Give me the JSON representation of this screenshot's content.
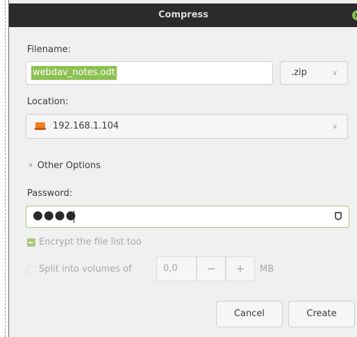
{
  "window": {
    "title": "Compress"
  },
  "filename": {
    "label": "Filename:",
    "value": "webdav_notes.odt",
    "extension": ".zip"
  },
  "location": {
    "label": "Location:",
    "value": "192.168.1.104"
  },
  "other_options": {
    "label": "Other Options"
  },
  "password": {
    "label": "Password:",
    "value": "●●●●"
  },
  "encrypt": {
    "label": "Encrypt the file list too",
    "checked": true
  },
  "split": {
    "label": "Split into volumes of",
    "value": "0,0",
    "minus": "−",
    "plus": "+",
    "unit": "MB",
    "checked": false
  },
  "buttons": {
    "cancel": "Cancel",
    "create": "Create"
  },
  "colors": {
    "accent": "#8cc152",
    "titlebar": "#2b2b2b",
    "location_icon": "#f08020"
  }
}
